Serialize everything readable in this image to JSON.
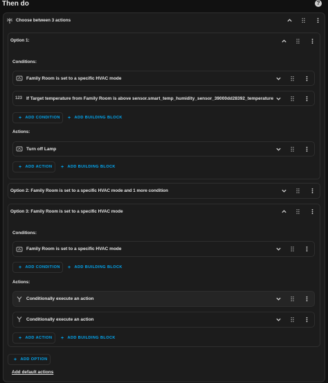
{
  "header": {
    "title": "Then do",
    "help_icon": "help-circle-icon"
  },
  "choose": {
    "title": "Choose between 3 actions",
    "icon": "choose-fork-icon"
  },
  "option1": {
    "title": "Option 1:",
    "conditions_label": "Conditions:",
    "conditions": [
      {
        "icon": "device-icon",
        "label": "Family Room is set to a specific HVAC mode"
      },
      {
        "icon": "numeric-123-icon",
        "icon_text": "123",
        "label": "If Target temperature from Family Room is above sensor.smart_temp_humidity_sensor_39000dd28392_temperature"
      }
    ],
    "add_condition": "ADD CONDITION",
    "add_building_block": "ADD BUILDING BLOCK",
    "actions_label": "Actions:",
    "actions": [
      {
        "icon": "device-icon",
        "label": "Turn off Lamp"
      }
    ],
    "add_action": "ADD ACTION",
    "add_building_block_2": "ADD BUILDING BLOCK"
  },
  "option2": {
    "title": "Option 2: Family Room is set to a specific HVAC mode and 1 more condition"
  },
  "option3": {
    "title": "Option 3: Family Room is set to a specific HVAC mode",
    "conditions_label": "Conditions:",
    "conditions": [
      {
        "icon": "device-icon",
        "label": "Family Room is set to a specific HVAC mode"
      }
    ],
    "add_condition": "ADD CONDITION",
    "add_building_block": "ADD BUILDING BLOCK",
    "actions_label": "Actions:",
    "actions": [
      {
        "icon": "if-fork-icon",
        "label": "Conditionally execute an action"
      },
      {
        "icon": "if-fork-icon",
        "label": "Conditionally execute an action"
      }
    ],
    "add_action": "ADD ACTION",
    "add_building_block_2": "ADD BUILDING BLOCK"
  },
  "footer": {
    "add_option": "ADD OPTION",
    "add_default": "Add default actions"
  },
  "colors": {
    "accent": "#03a9f4",
    "background": "#111111",
    "card": "#1c1c1c"
  }
}
